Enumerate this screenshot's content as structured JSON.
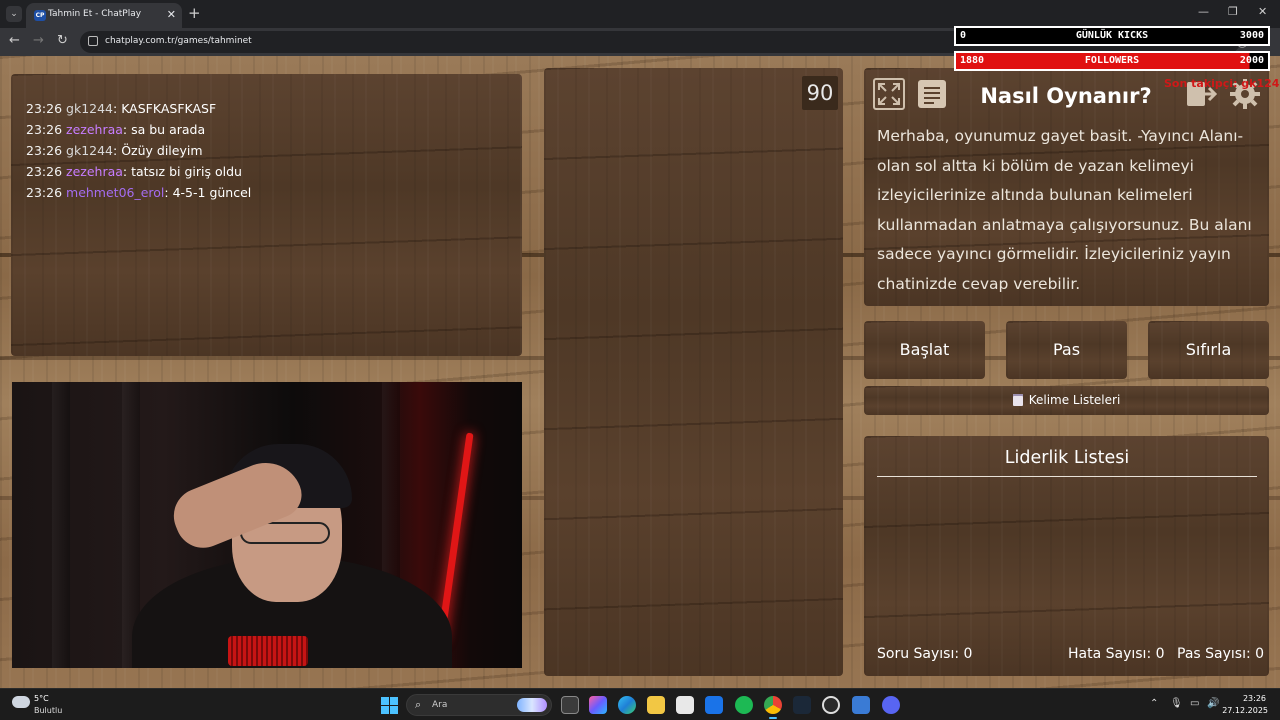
{
  "browser": {
    "tab_title": "Tahmin Et - ChatPlay",
    "tab_favicon_text": "CP",
    "url": "chatplay.com.tr/games/tahminet"
  },
  "chat": {
    "messages": [
      {
        "time": "23:26",
        "user": "gk1244",
        "text": "KASFKASFKASF"
      },
      {
        "time": "23:26",
        "user": "zezehraa",
        "text": "sa bu arada"
      },
      {
        "time": "23:26",
        "user": "gk1244",
        "text": "Özüy dileyim"
      },
      {
        "time": "23:26",
        "user": "zezehraa",
        "text": "tatsız bi giriş oldu"
      },
      {
        "time": "23:26",
        "user": "mehmet06_erol",
        "text": "4-5-1 güncel"
      }
    ],
    "user_colors": {
      "gk1244": "#d9d9d9",
      "zezehraa": "#c77dff",
      "mehmet06_erol": "#a46cf0"
    }
  },
  "game": {
    "timer": "90",
    "how_to_title": "Nasıl Oynanır?",
    "how_to_text": "Merhaba, oyunumuz gayet basit. -Yayıncı Alanı- olan sol altta ki bölüm de yazan kelimeyi izleyicilerinize altında bulunan kelimeleri kullanmadan anlatmaya çalışıyorsunuz. Bu alanı sadece yayıncı görmelidir. İzleyicileriniz yayın chatinizde cevap verebilir.",
    "start_label": "Başlat",
    "pass_label": "Pas",
    "reset_label": "Sıfırla",
    "word_lists_label": "Kelime Listeleri",
    "leaderboard_title": "Liderlik Listesi",
    "question_count": "Soru Sayısı: 0",
    "error_count": "Hata Sayısı: 0",
    "pass_count": "Pas Sayısı: 0"
  },
  "overlay": {
    "kicks": {
      "value": "0",
      "label": "GÜNLÜK KICKS",
      "goal": "3000"
    },
    "followers": {
      "value": "1880",
      "label": "FOLLOWERS",
      "goal": "2000",
      "progress": 0.94
    },
    "red_text": "Son takipçi: gk1244"
  },
  "taskbar": {
    "temperature": "5°C",
    "weather": "Bulutlu",
    "search_placeholder": "Ara",
    "time": "23:26",
    "date": "27.12.2025"
  }
}
